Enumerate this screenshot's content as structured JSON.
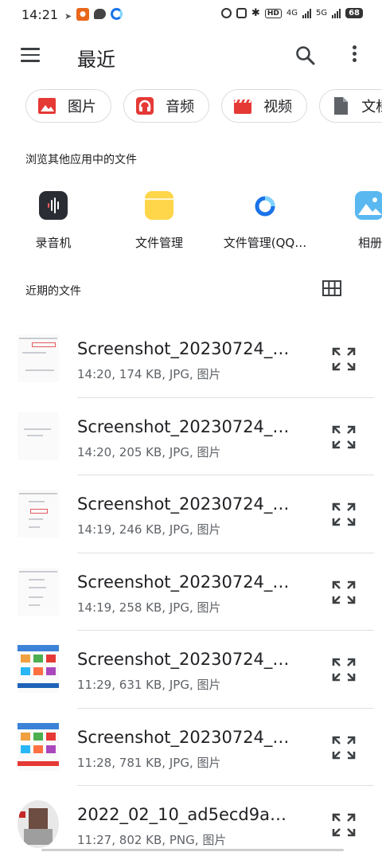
{
  "status_bar": {
    "time": "14:21",
    "network_4g": "4G",
    "network_5g": "5G",
    "hd_label": "HD",
    "battery": "68"
  },
  "header": {
    "title": "最近"
  },
  "chips": [
    {
      "label": "图片",
      "icon": "image-icon",
      "color": "#e53935"
    },
    {
      "label": "音频",
      "icon": "headphones-icon",
      "color": "#e53935"
    },
    {
      "label": "视频",
      "icon": "video-icon",
      "color": "#e53935"
    },
    {
      "label": "文档",
      "icon": "document-icon",
      "color": "#5f6368"
    }
  ],
  "browse_section": {
    "title": "浏览其他应用中的文件",
    "apps": [
      {
        "label": "录音机",
        "icon": "recorder-icon"
      },
      {
        "label": "文件管理",
        "icon": "folder-icon"
      },
      {
        "label": "文件管理(QQ…",
        "icon": "qq-browser-icon"
      },
      {
        "label": "相册",
        "icon": "gallery-icon"
      }
    ]
  },
  "recent_section": {
    "title": "近期的文件",
    "files": [
      {
        "name": "Screenshot_20230724_…",
        "time": "14:20,",
        "size": "174  KB,",
        "type": "JPG",
        "kind": "图片"
      },
      {
        "name": "Screenshot_20230724_…",
        "time": "14:20,",
        "size": "205  KB,",
        "type": "JPG",
        "kind": "图片"
      },
      {
        "name": "Screenshot_20230724_…",
        "time": "14:19,",
        "size": "246  KB,",
        "type": "JPG",
        "kind": "图片"
      },
      {
        "name": "Screenshot_20230724_…",
        "time": "14:19,",
        "size": "258  KB,",
        "type": "JPG",
        "kind": "图片"
      },
      {
        "name": "Screenshot_20230724_…",
        "time": "11:29,",
        "size": "631  KB,",
        "type": "JPG",
        "kind": "图片"
      },
      {
        "name": "Screenshot_20230724_…",
        "time": "11:28,",
        "size": "781  KB,",
        "type": "JPG",
        "kind": "图片"
      },
      {
        "name": "2022_02_10_ad5ecd9a…",
        "time": "11:27,",
        "size": "802  KB,",
        "type": "PNG",
        "kind": "图片"
      }
    ]
  }
}
